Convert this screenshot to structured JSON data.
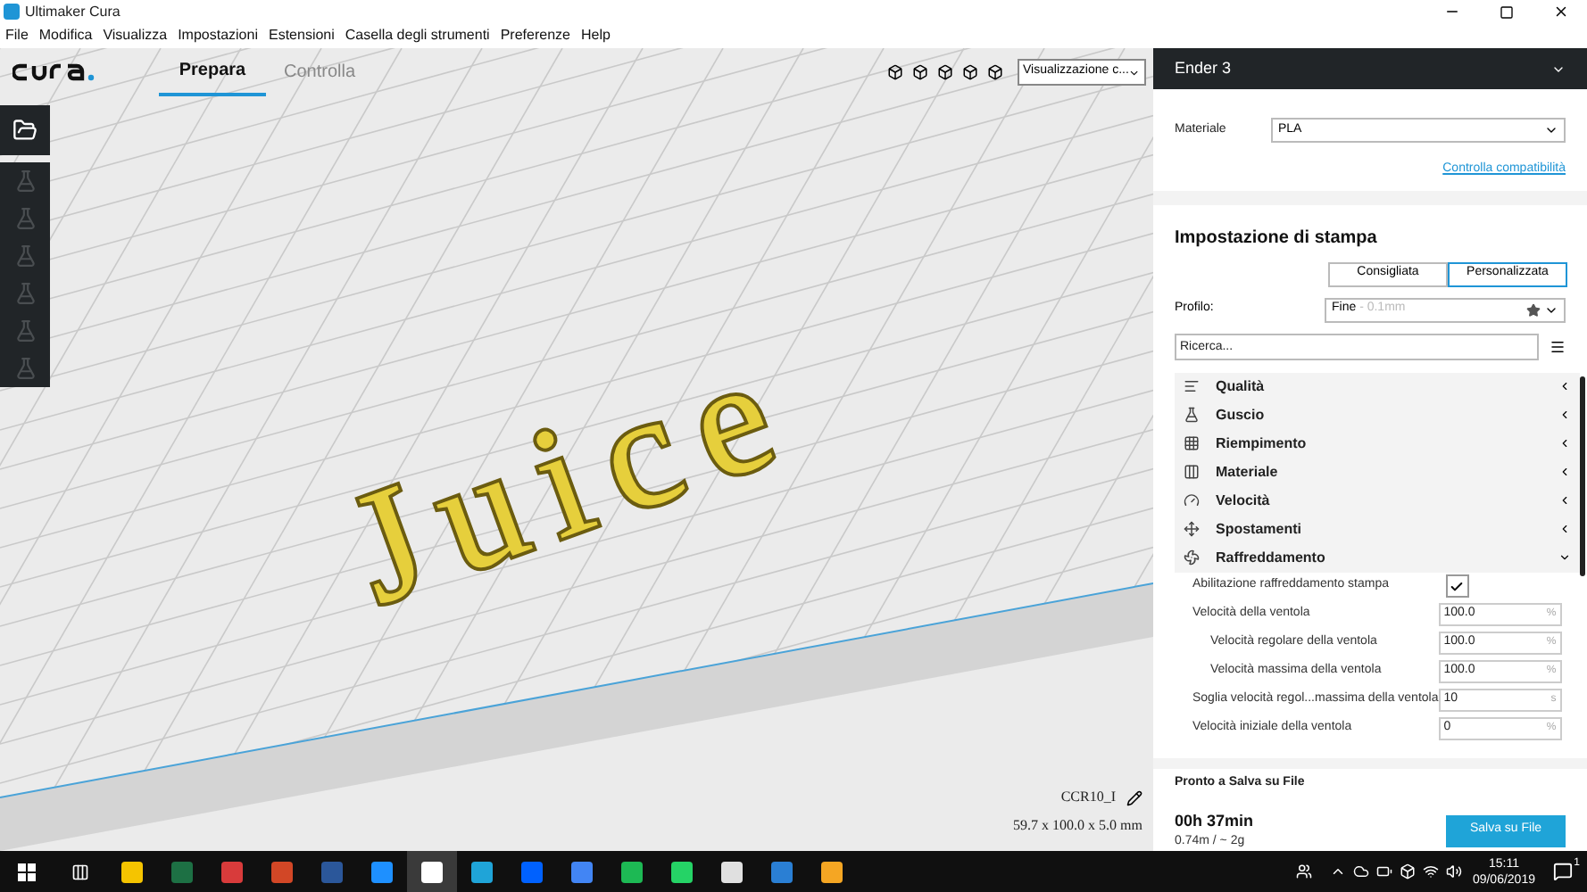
{
  "window": {
    "title": "Ultimaker Cura"
  },
  "menu": [
    "File",
    "Modifica",
    "Visualizza",
    "Impostazioni",
    "Estensioni",
    "Casella degli strumenti",
    "Preferenze",
    "Help"
  ],
  "header": {
    "tabs": [
      {
        "label": "Prepara",
        "selected": true
      },
      {
        "label": "Controlla",
        "selected": false
      }
    ],
    "view_select": "Visualizzazione c..."
  },
  "viewport": {
    "model_text": "Juice",
    "object_name": "CCR10_I",
    "dimensions": "59.7 x 100.0 x 5.0 mm"
  },
  "panel": {
    "printer": "Ender 3",
    "material_label": "Materiale",
    "material": "PLA",
    "compat_link": "Controlla compatibilità",
    "section_title": "Impostazione di stampa",
    "modes": [
      {
        "label": "Consigliata",
        "selected": false
      },
      {
        "label": "Personalizzata",
        "selected": true
      }
    ],
    "profile_label": "Profilo:",
    "profile": "Fine",
    "profile_detail": " - 0.1mm",
    "search": {
      "placeholder": "Ricerca..."
    },
    "categories": [
      {
        "label": "Qualità",
        "expanded": false
      },
      {
        "label": "Guscio",
        "expanded": false
      },
      {
        "label": "Riempimento",
        "expanded": false
      },
      {
        "label": "Materiale",
        "expanded": false
      },
      {
        "label": "Velocità",
        "expanded": false
      },
      {
        "label": "Spostamenti",
        "expanded": false
      },
      {
        "label": "Raffreddamento",
        "expanded": true
      }
    ],
    "settings": [
      {
        "kind": "checkbox",
        "label": "Abilitazione raffreddamento stampa",
        "checked": true
      },
      {
        "kind": "number",
        "label": "Velocità della ventola",
        "value": "100.0",
        "unit": "%",
        "children": [
          {
            "kind": "number",
            "label": "Velocità regolare della ventola",
            "value": "100.0",
            "unit": "%"
          },
          {
            "kind": "number",
            "label": "Velocità massima della ventola",
            "value": "100.0",
            "unit": "%"
          }
        ]
      },
      {
        "kind": "number",
        "label": "Soglia velocità regol...massima della ventola",
        "value": "10",
        "unit": "s"
      },
      {
        "kind": "number",
        "label": "Velocità iniziale della ventola",
        "value": "0",
        "unit": "%"
      }
    ],
    "status": "Pronto a Salva su File",
    "time": "00h 37min",
    "usage": "0.74m / ~ 2g",
    "save_button": "Salva su File"
  },
  "taskbar": {
    "apps": [
      {
        "selected": false
      },
      {
        "selected": false
      },
      {
        "selected": false
      },
      {
        "selected": false
      },
      {
        "selected": false
      },
      {
        "selected": false
      },
      {
        "selected": true
      },
      {
        "selected": false
      },
      {
        "selected": false
      },
      {
        "selected": false
      },
      {
        "selected": false
      },
      {
        "selected": false
      },
      {
        "selected": false
      },
      {
        "selected": false
      },
      {
        "selected": false
      }
    ],
    "time": "15:11",
    "date": "09/06/2019",
    "notifications": "1"
  }
}
